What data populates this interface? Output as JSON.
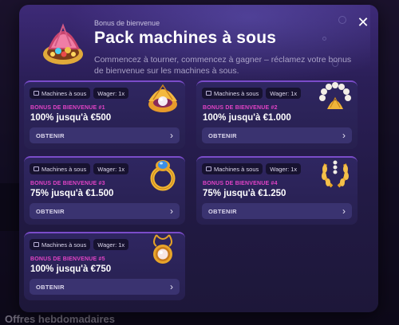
{
  "page": {
    "background_footer_title": "Offres hebdomadaires"
  },
  "modal": {
    "subtitle": "Bonus de bienvenue",
    "title": "Pack machines à sous",
    "description": "Commencez à tourner, commencez à gagner – réclamez votre bonus de bienvenue sur les machines à sous.",
    "close_icon": "close-icon",
    "header_icon": "treasure-shell-icon"
  },
  "cards": [
    {
      "tag_category": "Machines à sous",
      "tag_wager": "Wager: 1x",
      "label": "BONUS DE BIENVENUE #1",
      "value": "100% jusqu'à €500",
      "button": "OBTENIR",
      "art": "pearl-clam-icon"
    },
    {
      "tag_category": "Machines à sous",
      "tag_wager": "Wager: 1x",
      "label": "BONUS DE BIENVENUE #2",
      "value": "100% jusqu'à €1.000",
      "button": "OBTENIR",
      "art": "pearl-bracelet-icon"
    },
    {
      "tag_category": "Machines à sous",
      "tag_wager": "Wager: 1x",
      "label": "BONUS DE BIENVENUE #3",
      "value": "75% jusqu'à €1.500",
      "button": "OBTENIR",
      "art": "gold-ring-icon"
    },
    {
      "tag_category": "Machines à sous",
      "tag_wager": "Wager: 1x",
      "label": "BONUS DE BIENVENUE #4",
      "value": "75% jusqu'à €1.250",
      "button": "OBTENIR",
      "art": "gold-wreath-icon"
    },
    {
      "tag_category": "Machines à sous",
      "tag_wager": "Wager: 1x",
      "label": "BONUS DE BIENVENUE #5",
      "value": "100% jusqu'à €750",
      "button": "OBTENIR",
      "art": "pearl-locket-icon"
    }
  ],
  "colors": {
    "accent_label": "#e243c6",
    "card_bg": "#2f2661",
    "button_bg": "#3a3370"
  }
}
